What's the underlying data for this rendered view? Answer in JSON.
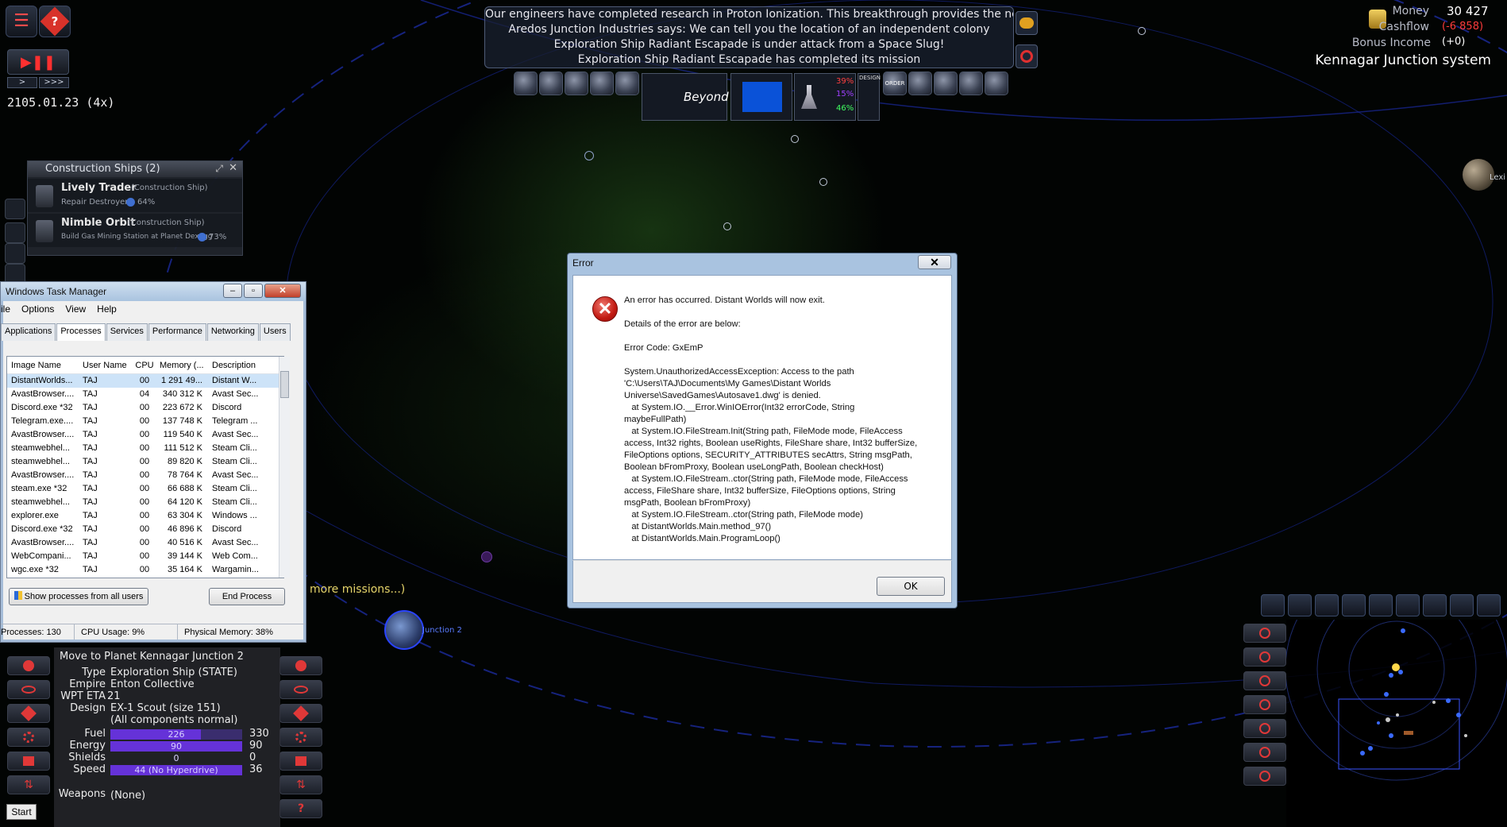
{
  "top_left": {
    "menu_icon": "list-icon",
    "help_icon": "help-icon",
    "speed_slow": ">",
    "speed_fast": ">>>",
    "date": "2105.01.23",
    "speed_label": "(4x)"
  },
  "messages": [
    "Our engineers have completed research in Proton Ionization. This breakthrough provides  the new compo",
    "Aredos Junction Industries says: We can tell you the location of an independent colony",
    "Exploration Ship Radiant Escapade is under attack from a Space Slug!",
    "Exploration Ship Radiant Escapade has completed its mission"
  ],
  "top_bar": {
    "empire_label": "Beyond",
    "research_pcts": [
      "39%",
      "15%",
      "46%"
    ],
    "design_label": "DESIGN",
    "order_label": "ORDER"
  },
  "finance": {
    "money_label": "Money",
    "money_value": "30  427",
    "cashflow_label": "Cashflow",
    "cashflow_value": "(-6  858)",
    "bonus_label": "Bonus Income",
    "bonus_value": "(+0)",
    "system_name": "Kennagar Junction system"
  },
  "construction": {
    "title": "Construction Ships (2)",
    "ships": [
      {
        "name": "Lively Trader",
        "type": "(Construction Ship)",
        "task": "Repair Destroyer",
        "progress": "64%"
      },
      {
        "name": "Nimble Orbit",
        "type": "(Construction Ship)",
        "task": "Build Gas Mining Station at Planet Dexygg",
        "progress": "73%"
      }
    ]
  },
  "task_manager": {
    "title": "Windows Task Manager",
    "menu": [
      "ile",
      "Options",
      "View",
      "Help"
    ],
    "tabs": [
      "Applications",
      "Processes",
      "Services",
      "Performance",
      "Networking",
      "Users"
    ],
    "active_tab": "Processes",
    "columns": [
      "Image Name",
      "User Name",
      "CPU",
      "Memory (...",
      "Description"
    ],
    "rows": [
      [
        "DistantWorlds...",
        "TAJ",
        "00",
        "1 291 49...",
        "Distant W..."
      ],
      [
        "AvastBrowser....",
        "TAJ",
        "04",
        "340 312 K",
        "Avast Sec..."
      ],
      [
        "Discord.exe *32",
        "TAJ",
        "00",
        "223 672 K",
        "Discord"
      ],
      [
        "Telegram.exe....",
        "TAJ",
        "00",
        "137 748 K",
        "Telegram ..."
      ],
      [
        "AvastBrowser....",
        "TAJ",
        "00",
        "119 540 K",
        "Avast Sec..."
      ],
      [
        "steamwebhel...",
        "TAJ",
        "00",
        "111 512 K",
        "Steam Cli..."
      ],
      [
        "steamwebhel...",
        "TAJ",
        "00",
        "89 820 K",
        "Steam Cli..."
      ],
      [
        "AvastBrowser....",
        "TAJ",
        "00",
        "78 764 K",
        "Avast Sec..."
      ],
      [
        "steam.exe *32",
        "TAJ",
        "00",
        "66 688 K",
        "Steam Cli..."
      ],
      [
        "steamwebhel...",
        "TAJ",
        "00",
        "64 120 K",
        "Steam Cli..."
      ],
      [
        "explorer.exe",
        "TAJ",
        "00",
        "63 304 K",
        "Windows ..."
      ],
      [
        "Discord.exe *32",
        "TAJ",
        "00",
        "46 896 K",
        "Discord"
      ],
      [
        "AvastBrowser....",
        "TAJ",
        "00",
        "40 516 K",
        "Avast Sec..."
      ],
      [
        "WebCompani...",
        "TAJ",
        "00",
        "39 144 K",
        "Web Com..."
      ],
      [
        "wgc.exe *32",
        "TAJ",
        "00",
        "35 164 K",
        "Wargamin..."
      ]
    ],
    "show_all_label": "Show processes from all users",
    "end_process_label": "End Process",
    "status_processes": "Processes: 130",
    "status_cpu": "CPU Usage: 9%",
    "status_memory": "Physical Memory: 38%"
  },
  "error_dialog": {
    "title": "Error",
    "close": "✕",
    "line1": "An error has occurred. Distant Worlds will now exit.",
    "line2": "Details of the error are below:",
    "line3": "Error Code: GxEmP",
    "details": "System.UnauthorizedAccessException: Access to the path\n'C:\\Users\\TAJ\\Documents\\My Games\\Distant Worlds\nUniverse\\SavedGames\\Autosave1.dwg' is denied.\n   at System.IO.__Error.WinIOError(Int32 errorCode, String\nmaybeFullPath)\n   at System.IO.FileStream.Init(String path, FileMode mode, FileAccess\naccess, Int32 rights, Boolean useRights, FileShare share, Int32 bufferSize,\nFileOptions options, SECURITY_ATTRIBUTES secAttrs, String msgPath,\nBoolean bFromProxy, Boolean useLongPath, Boolean checkHost)\n   at System.IO.FileStream..ctor(String path, FileMode mode, FileAccess\naccess, FileShare share, Int32 bufferSize, FileOptions options, String\nmsgPath, Boolean bFromProxy)\n   at System.IO.FileStream..ctor(String path, FileMode mode)\n   at DistantWorlds.Main.method_97()\n   at DistantWorlds.Main.ProgramLoop()",
    "ok": "OK"
  },
  "missions_text": "more missions...)",
  "planet_label": "Junction 2",
  "lexi_label": "Lexi",
  "ship_info": {
    "mission": "Move to Planet Kennagar Junction 2",
    "type_label": "Type",
    "type_value": "Exploration Ship (STATE)",
    "empire_label": "Empire",
    "empire_value": "Enton Collective",
    "wpt_label": "WPT ETA",
    "wpt_value": "21",
    "design_label": "Design",
    "design_value": "EX-1 Scout (size 151)",
    "design_note": "(All components normal)",
    "fuel_label": "Fuel",
    "fuel_current": "226",
    "fuel_max": "330",
    "fuel_fraction": 0.685,
    "energy_label": "Energy",
    "energy_current": "90",
    "energy_max": "90",
    "energy_fraction": 1.0,
    "shields_label": "Shields",
    "shields_current": "0",
    "shields_max": "0",
    "shields_fraction": 0.0,
    "speed_label": "Speed",
    "speed_current": "44 (No Hyperdrive)",
    "speed_max": "36",
    "speed_fraction": 1.0,
    "weapons_label": "Weapons",
    "weapons_value": "(None)"
  },
  "start_label": "Start",
  "colors": {
    "accent_purple": "#6532d8",
    "cashflow_red": "#ff3b3b",
    "error_red": "#c21a12",
    "orbit_blue": "#2a3cff"
  }
}
